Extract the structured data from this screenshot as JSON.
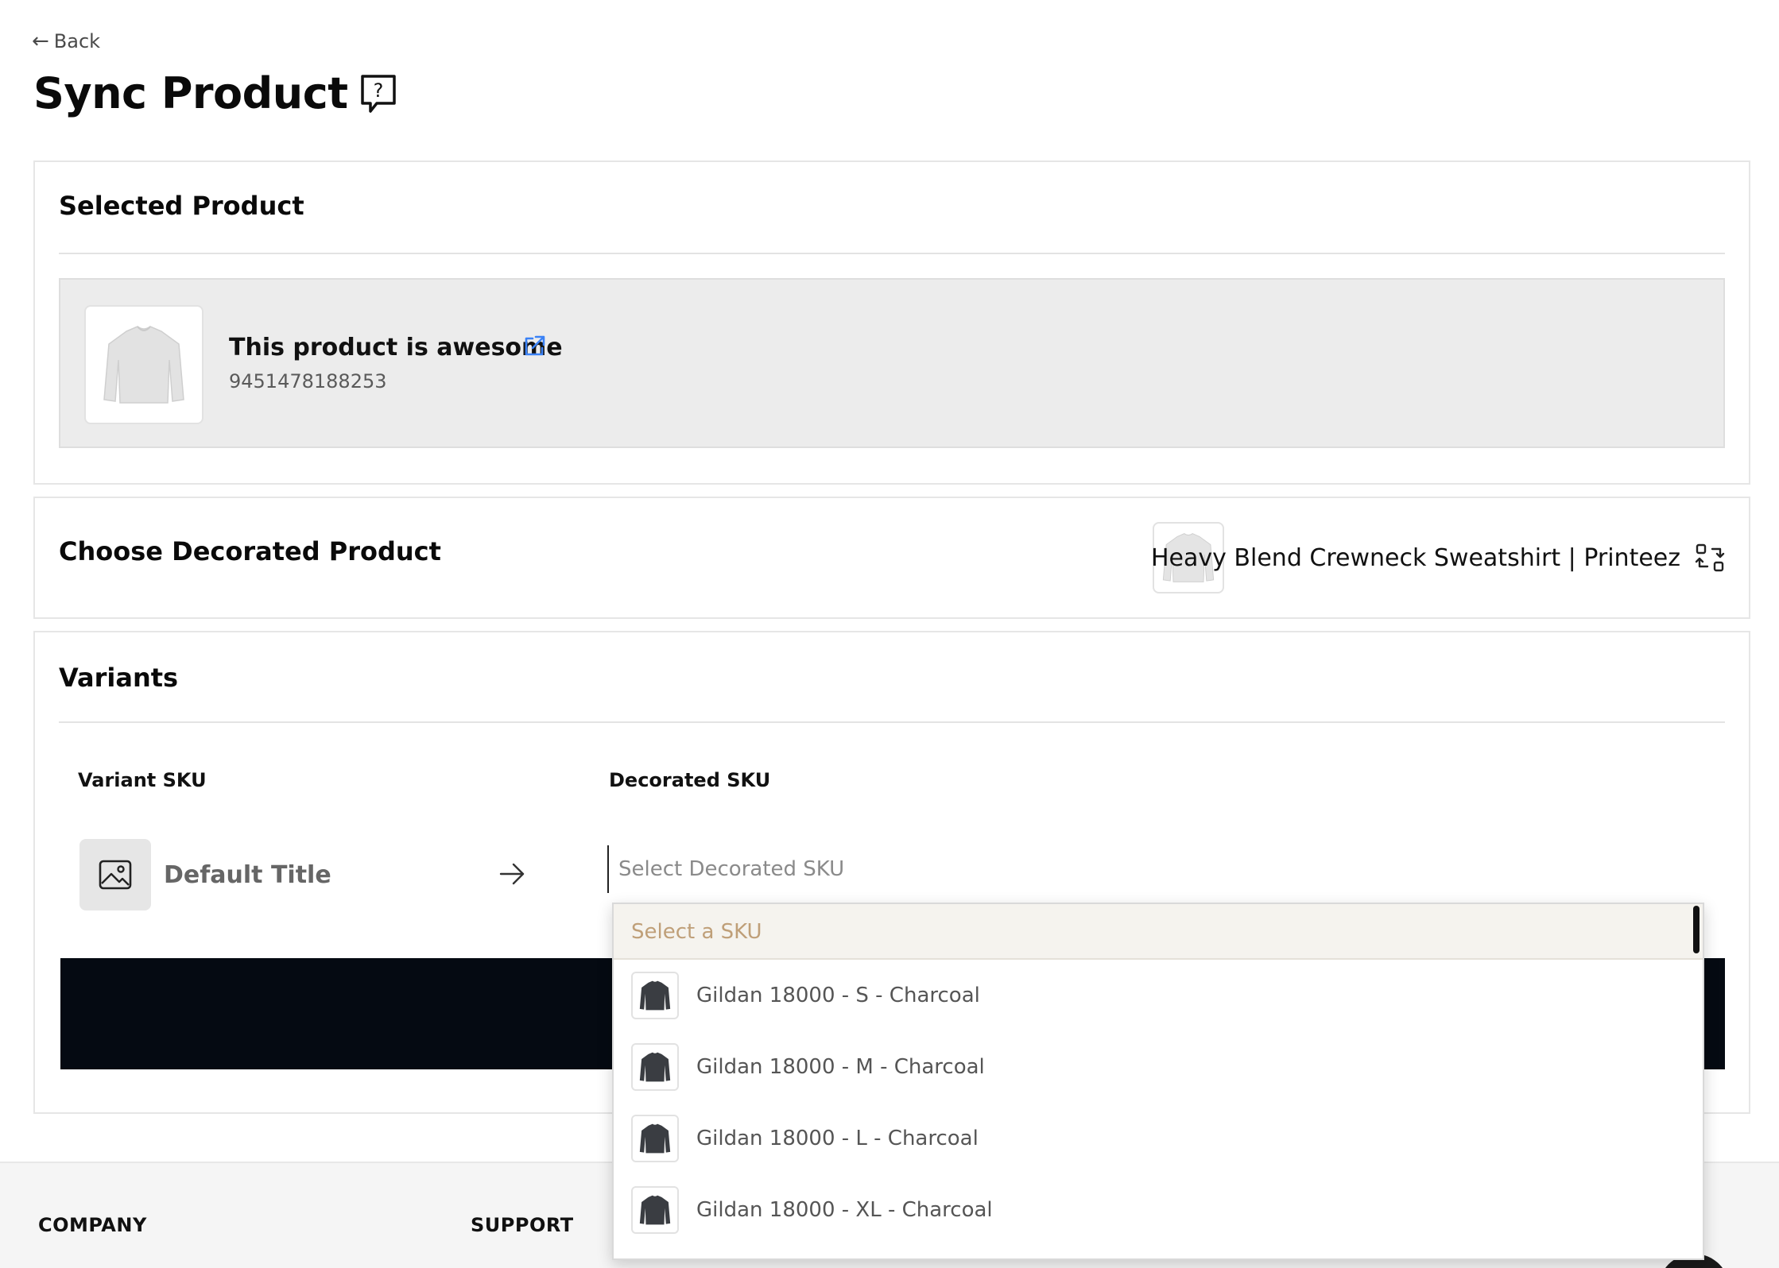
{
  "header": {
    "back_label": "Back",
    "page_title": "Sync Product"
  },
  "selected_product": {
    "heading": "Selected Product",
    "name": "This product is awesome",
    "id": "9451478188253"
  },
  "choose_decorated": {
    "heading": "Choose Decorated Product",
    "product_name": "Heavy Blend Crewneck Sweatshirt | Printeez"
  },
  "variants": {
    "heading": "Variants",
    "col_variant_sku": "Variant SKU",
    "col_decorated_sku": "Decorated SKU",
    "variant_title": "Default Title",
    "sku_placeholder": "Select Decorated SKU"
  },
  "dropdown": {
    "header": "Select a SKU",
    "items": [
      {
        "label": "Gildan 18000 - S - Charcoal"
      },
      {
        "label": "Gildan 18000 - M - Charcoal"
      },
      {
        "label": "Gildan 18000 - L - Charcoal"
      },
      {
        "label": "Gildan 18000 - XL - Charcoal"
      }
    ]
  },
  "footer": {
    "company": "COMPANY",
    "support": "SUPPORT"
  },
  "colors": {
    "link_blue": "#3b82f6",
    "dropdown_header_bg": "#f5f3ee",
    "dropdown_header_text": "#bf9f78",
    "black_bar": "#050a12"
  }
}
